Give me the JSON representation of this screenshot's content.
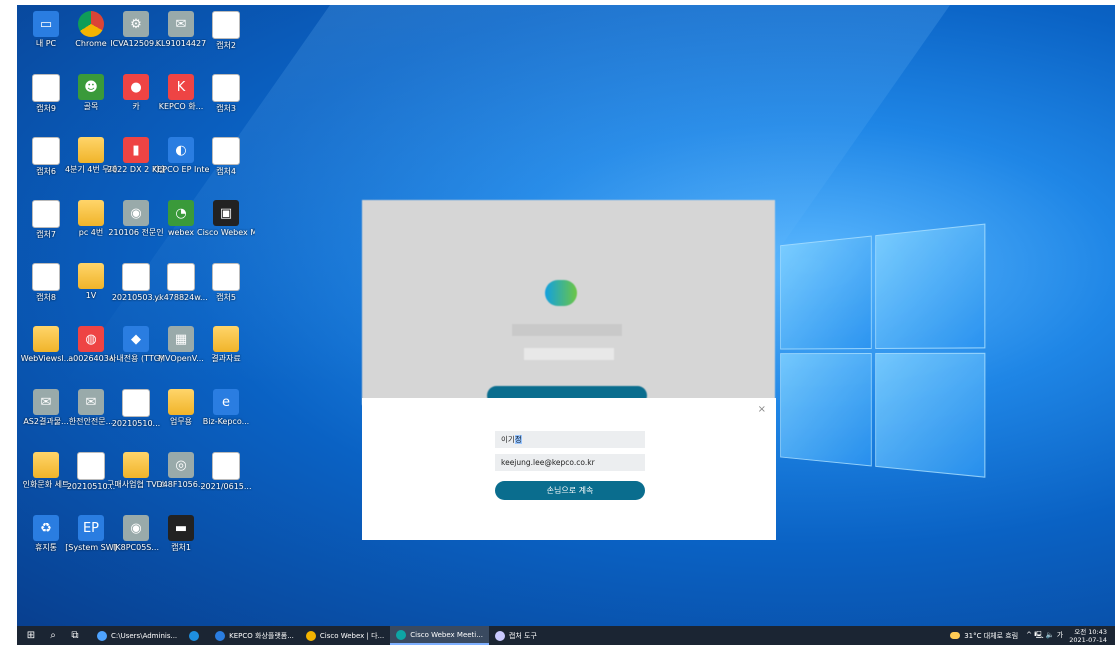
{
  "desktop_icons": [
    {
      "label": "내 PC",
      "kind": "g-blue",
      "glyph": "▭"
    },
    {
      "label": "Chrome",
      "kind": "g-chrome",
      "glyph": ""
    },
    {
      "label": "ICVA12509...",
      "kind": "g-gray",
      "glyph": "⚙"
    },
    {
      "label": "KL91014427",
      "kind": "g-gray",
      "glyph": "✉"
    },
    {
      "label": "캡처2",
      "kind": "g-doc",
      "glyph": ""
    },
    {
      "label": "캡처9",
      "kind": "g-doc",
      "glyph": ""
    },
    {
      "label": "골목",
      "kind": "g-green",
      "glyph": "☻"
    },
    {
      "label": "카",
      "kind": "g-app",
      "glyph": "●"
    },
    {
      "label": "KEPCO 화...",
      "kind": "g-app",
      "glyph": "K"
    },
    {
      "label": "캡처3",
      "kind": "g-doc",
      "glyph": ""
    },
    {
      "label": "캡처6",
      "kind": "g-doc",
      "glyph": ""
    },
    {
      "label": "4분기 4번 무대",
      "kind": "g-folder",
      "glyph": ""
    },
    {
      "label": "2022 DX 2 기술개발",
      "kind": "g-app",
      "glyph": "▮"
    },
    {
      "label": "KEPCO EP Internet",
      "kind": "g-blue",
      "glyph": "◐"
    },
    {
      "label": "캡처4",
      "kind": "g-doc",
      "glyph": ""
    },
    {
      "label": "캡처7",
      "kind": "g-doc",
      "glyph": ""
    },
    {
      "label": "pc 4번",
      "kind": "g-folder",
      "glyph": ""
    },
    {
      "label": "210106 전문인",
      "kind": "g-gray",
      "glyph": "◉"
    },
    {
      "label": "webex",
      "kind": "g-green",
      "glyph": "◔"
    },
    {
      "label": "Cisco Webex Meetings",
      "kind": "g-dark",
      "glyph": "▣"
    },
    {
      "label": "캡처8",
      "kind": "g-doc",
      "glyph": ""
    },
    {
      "label": "1V",
      "kind": "g-folder",
      "glyph": ""
    },
    {
      "label": "20210503...",
      "kind": "g-doc",
      "glyph": "e"
    },
    {
      "label": "yk478824w...",
      "kind": "g-doc",
      "glyph": ""
    },
    {
      "label": "캡처5",
      "kind": "g-doc",
      "glyph": ""
    },
    {
      "label": "WebViewsl...",
      "kind": "g-folder",
      "glyph": ""
    },
    {
      "label": "a0026403a",
      "kind": "g-app",
      "glyph": "◍"
    },
    {
      "label": "사내전용 (TTG)",
      "kind": "g-blue",
      "glyph": "◆"
    },
    {
      "label": "MVOpenV...",
      "kind": "g-gray",
      "glyph": "▦"
    },
    {
      "label": "결과자료",
      "kind": "g-folder",
      "glyph": ""
    },
    {
      "label": "AS2결과물...",
      "kind": "g-gray",
      "glyph": "✉"
    },
    {
      "label": "한전안전문...",
      "kind": "g-gray",
      "glyph": "✉"
    },
    {
      "label": "20210510...",
      "kind": "g-doc",
      "glyph": "e"
    },
    {
      "label": "업무용",
      "kind": "g-folder",
      "glyph": ""
    },
    {
      "label": "Biz-Kepco...",
      "kind": "g-blue",
      "glyph": "e"
    },
    {
      "label": "인화문화 세트",
      "kind": "g-folder",
      "glyph": ""
    },
    {
      "label": "20210510...",
      "kind": "g-doc",
      "glyph": "e"
    },
    {
      "label": "구매사업협 TV 스트림",
      "kind": "g-folder",
      "glyph": ""
    },
    {
      "label": "D48F1056...",
      "kind": "g-gray",
      "glyph": "◎"
    },
    {
      "label": "2021/0615...",
      "kind": "g-doc",
      "glyph": "e"
    },
    {
      "label": "휴지통",
      "kind": "g-blue",
      "glyph": "♻"
    },
    {
      "label": "[System SW]",
      "kind": "g-blue",
      "glyph": "EP"
    },
    {
      "label": "IK8PC05S...",
      "kind": "g-gray",
      "glyph": "◉"
    },
    {
      "label": "캡처1",
      "kind": "g-dark",
      "glyph": "▬"
    }
  ],
  "dialog": {
    "close_glyph": "×",
    "name_value": "이기",
    "name_selected": "정",
    "email_value": "keejung.lee@kepco.co.kr",
    "guest_button": "손님으로 계속"
  },
  "taskbar": {
    "start_glyph": "⊞",
    "search_glyph": "⌕",
    "taskview_glyph": "⧉",
    "items": [
      {
        "label": "C:\\Users\\Adminis...",
        "color": "#4ea3ff",
        "active": false
      },
      {
        "label": "",
        "color": "#1e8fe0",
        "active": false
      },
      {
        "label": "KEPCO 화상플랫폼...",
        "color": "#2a7de1",
        "active": false
      },
      {
        "label": "Cisco Webex | 다...",
        "color": "#f4b400",
        "active": false
      },
      {
        "label": "Cisco Webex Meeti...",
        "color": "#0ea5a5",
        "active": true
      },
      {
        "label": "캡처 도구",
        "color": "#c9c9ff",
        "active": false
      }
    ],
    "weather": "31°C 대체로 흐림",
    "tray_glyphs": "^ 🖳 🔈 가",
    "time": "오전 10:43",
    "date": "2021-07-14"
  }
}
